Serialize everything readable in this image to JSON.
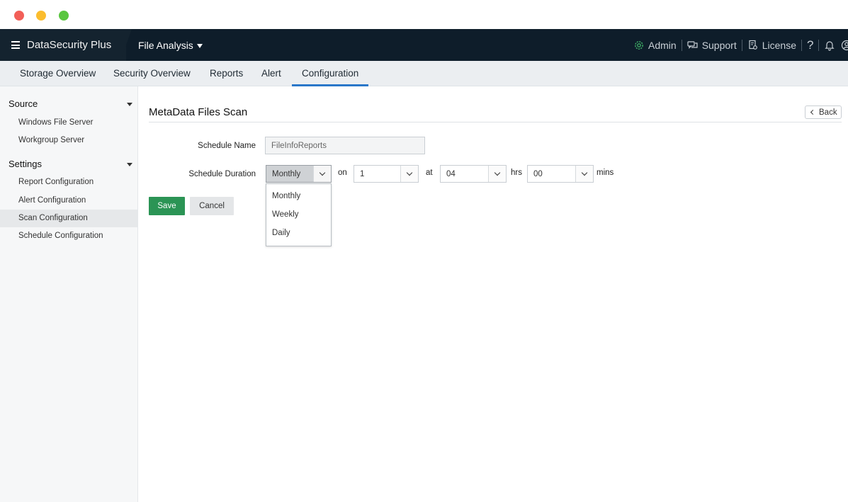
{
  "app": {
    "name": "DataSecurity Plus",
    "module": "File Analysis"
  },
  "topbar": {
    "admin_label": "Admin",
    "support_label": "Support",
    "license_label": "License",
    "help_glyph": "?"
  },
  "tabs": [
    {
      "label": "Storage Overview"
    },
    {
      "label": "Security Overview"
    },
    {
      "label": "Reports"
    },
    {
      "label": "Alert"
    },
    {
      "label": "Configuration"
    }
  ],
  "sidebar": {
    "source": {
      "heading": "Source",
      "items": [
        {
          "label": "Windows File Server"
        },
        {
          "label": "Workgroup Server"
        }
      ]
    },
    "settings": {
      "heading": "Settings",
      "items": [
        {
          "label": "Report Configuration"
        },
        {
          "label": "Alert Configuration"
        },
        {
          "label": "Scan Configuration"
        },
        {
          "label": "Schedule Configuration"
        }
      ]
    }
  },
  "main": {
    "title": "MetaData Files Scan",
    "back_label": "Back",
    "form": {
      "schedule_name_label": "Schedule Name",
      "schedule_name_value": "FileInfoReports",
      "schedule_duration_label": "Schedule Duration",
      "duration_value": "Monthly",
      "on_label": "on",
      "day_value": "1",
      "at_label": "at",
      "hrs_value": "04",
      "hrs_label": "hrs",
      "mins_value": "00",
      "mins_label": "mins"
    },
    "duration_options": [
      "Monthly",
      "Weekly",
      "Daily"
    ],
    "save_label": "Save",
    "cancel_label": "Cancel"
  },
  "colors": {
    "topbar_bg": "#0e1d2a",
    "active_tab_underline": "#2a77c9",
    "save_button": "#2b9455",
    "admin_icon": "#3fb067"
  }
}
